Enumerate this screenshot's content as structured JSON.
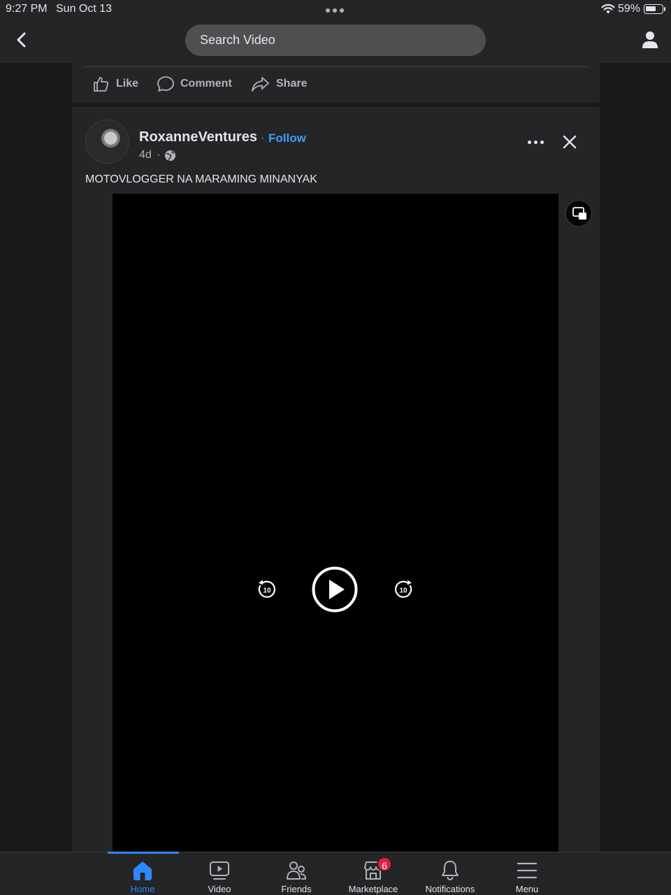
{
  "status_bar": {
    "time": "9:27 PM",
    "date": "Sun Oct 13",
    "battery_text": "59%",
    "battery_level": 0.59
  },
  "top_nav": {
    "search_placeholder": "Search Video"
  },
  "prev_post_actions": {
    "like_label": "Like",
    "comment_label": "Comment",
    "share_label": "Share"
  },
  "post": {
    "author": "RoxanneVentures",
    "separator": "·",
    "follow_label": "Follow",
    "time_ago": "4d",
    "text": "MOTOVLOGGER NA MARAMING MINANYAK",
    "rewind_seconds": "10",
    "forward_seconds": "10"
  },
  "tab_bar": {
    "tabs": [
      {
        "label": "Home",
        "icon": "home-icon",
        "active": true
      },
      {
        "label": "Video",
        "icon": "video-icon",
        "active": false
      },
      {
        "label": "Friends",
        "icon": "friends-icon",
        "active": false
      },
      {
        "label": "Marketplace",
        "icon": "marketplace-icon",
        "active": false,
        "badge": "6"
      },
      {
        "label": "Notifications",
        "icon": "bell-icon",
        "active": false
      },
      {
        "label": "Menu",
        "icon": "menu-icon",
        "active": false
      }
    ]
  },
  "colors": {
    "background": "#18191a",
    "surface": "#242526",
    "accent": "#2d88ff",
    "follow": "#4599ff",
    "badge": "#e41e3f"
  }
}
